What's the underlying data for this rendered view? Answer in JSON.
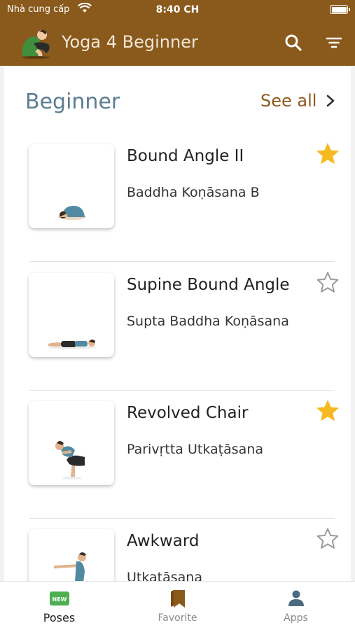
{
  "status_bar": {
    "carrier": "Nhà cung cấp",
    "time": "8:40 CH"
  },
  "app": {
    "title": "Yoga 4 Beginner"
  },
  "section": {
    "title": "Beginner",
    "see_all": "See all"
  },
  "poses": [
    {
      "name": "Bound Angle II",
      "sanskrit": "Baddha Koṇāsana B",
      "favorite": true
    },
    {
      "name": "Supine Bound Angle",
      "sanskrit": "Supta Baddha Koṇāsana",
      "favorite": false
    },
    {
      "name": "Revolved Chair",
      "sanskrit": "Parivṛtta Utkaṭāsana",
      "favorite": true
    },
    {
      "name": "Awkward",
      "sanskrit": "Utkaṭāsana",
      "favorite": false
    }
  ],
  "tabs": [
    {
      "label": "Poses",
      "icon": "new-badge-icon",
      "badge": "NEW",
      "active": true
    },
    {
      "label": "Favorite",
      "icon": "bookmark-icon",
      "active": false
    },
    {
      "label": "Apps",
      "icon": "person-icon",
      "active": false
    }
  ],
  "colors": {
    "header": "#8a5a1c",
    "accent": "#8a5a1c",
    "section_title": "#5b7e90",
    "star_filled": "#f5b921",
    "tab_badge": "#4caf50"
  }
}
